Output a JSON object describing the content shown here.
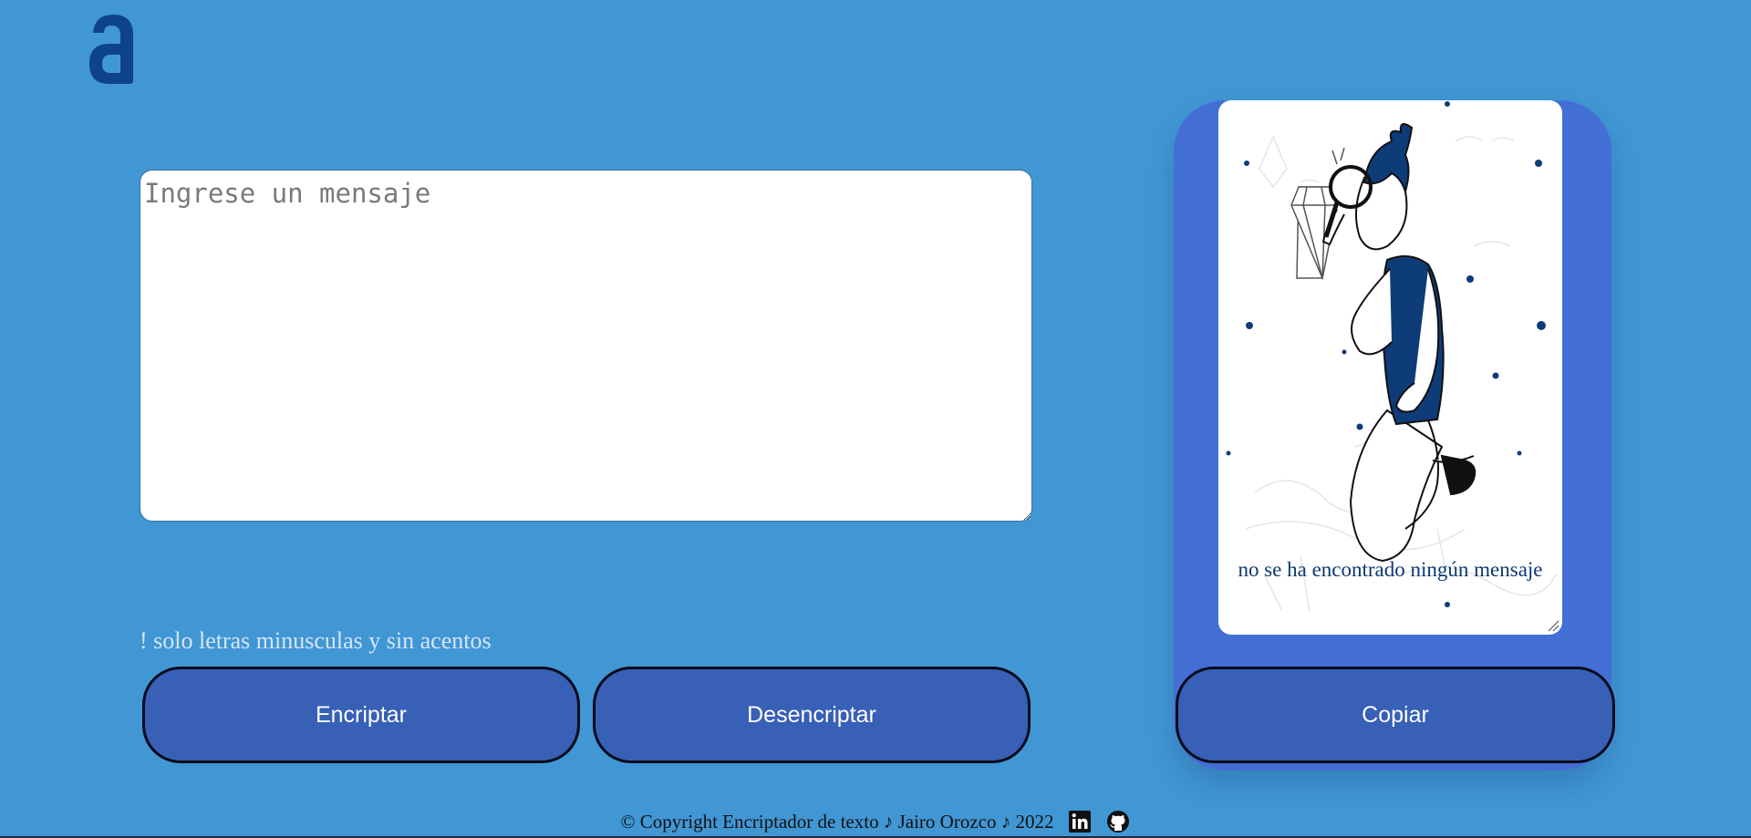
{
  "brand": {
    "logo_icon": "letter-a-logo-icon",
    "logo_color": "#0e4389"
  },
  "input": {
    "placeholder": "Ingrese un mensaje",
    "value": ""
  },
  "warning": {
    "text": "! solo letras minusculas y sin acentos"
  },
  "actions": {
    "encrypt_label": "Encriptar",
    "decrypt_label": "Desencriptar",
    "copy_label": "Copiar"
  },
  "output": {
    "empty_text": "no se ha encontrado ningún mensaje",
    "illustration_icon": "person-with-magnifier-illustration"
  },
  "footer": {
    "copyright": "© Copyright Encriptador de texto ♪ Jairo Orozco ♪ 2022",
    "icons": [
      "linkedin-icon",
      "github-icon"
    ]
  },
  "colors": {
    "background": "#4196d4",
    "button": "#3760b6",
    "panel": "#436fd5"
  }
}
